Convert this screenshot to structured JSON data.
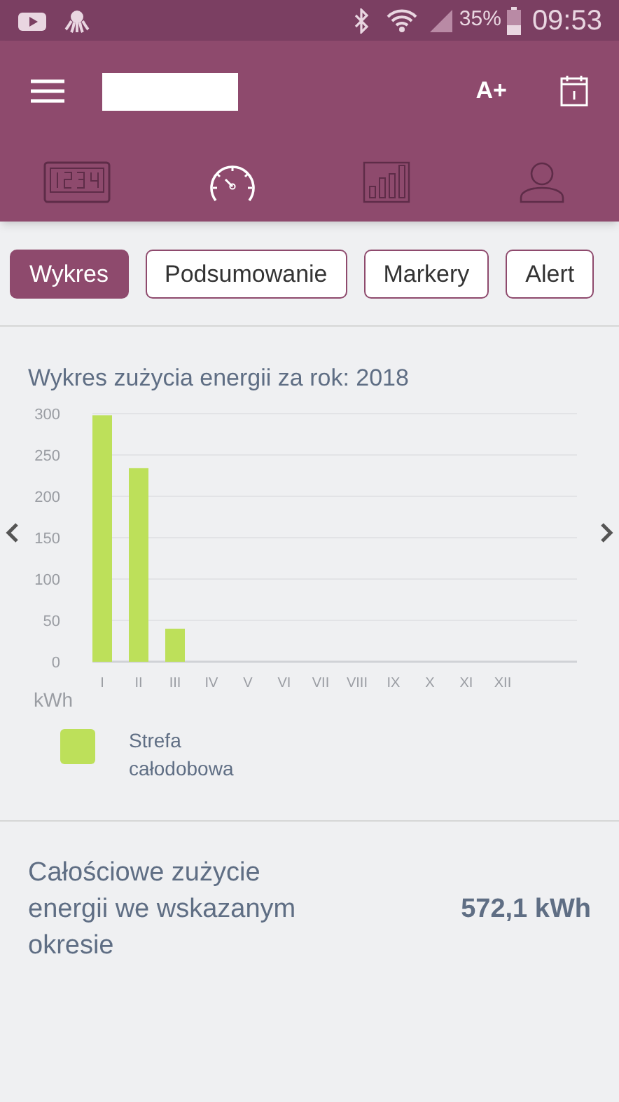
{
  "status_bar": {
    "battery": "35%",
    "time": "09:53"
  },
  "app_bar": {
    "font_button": "A+"
  },
  "nav_tabs": [
    {
      "kind": "display",
      "selected": false
    },
    {
      "kind": "gauge",
      "selected": true
    },
    {
      "kind": "bars",
      "selected": false
    },
    {
      "kind": "person",
      "selected": false
    }
  ],
  "view_buttons": [
    {
      "label": "Wykres",
      "selected": true
    },
    {
      "label": "Podsumowanie",
      "selected": false
    },
    {
      "label": "Markery",
      "selected": false
    },
    {
      "label": "Alert",
      "selected": false
    }
  ],
  "chart_title": "Wykres zużycia energii za rok: 2018",
  "chart_data": {
    "type": "bar",
    "ylabel": "kWh",
    "categories": [
      "I",
      "II",
      "III",
      "IV",
      "V",
      "VI",
      "VII",
      "VIII",
      "IX",
      "X",
      "XI",
      "XII"
    ],
    "series": [
      {
        "name": "Strefa całodobowa",
        "color": "#bde05a",
        "values": [
          298,
          234,
          40,
          0,
          0,
          0,
          0,
          0,
          0,
          0,
          0,
          0
        ]
      }
    ],
    "ylim": [
      0,
      300
    ],
    "yticks": [
      0,
      50,
      100,
      150,
      200,
      250,
      300
    ],
    "grid": true
  },
  "total": {
    "label": "Całościowe zużycie energii we wskazanym okresie",
    "value": "572,1 kWh"
  }
}
